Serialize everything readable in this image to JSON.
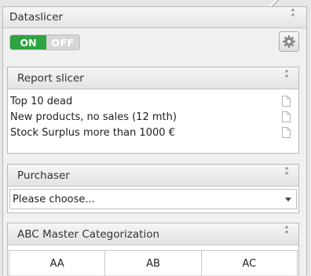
{
  "dataslicer": {
    "title": "Dataslicer"
  },
  "toggle": {
    "on_label": "ON",
    "off_label": "OFF",
    "state": "on"
  },
  "report_slicer": {
    "title": "Report slicer",
    "items": [
      {
        "label": "Top 10 dead"
      },
      {
        "label": "New products, no sales (12 mth)"
      },
      {
        "label": "Stock Surplus more than 1000 €"
      }
    ]
  },
  "purchaser": {
    "title": "Purchaser",
    "selected": "Please choose..."
  },
  "abc": {
    "title": "ABC Master Categorization",
    "cells": [
      {
        "label": "AA"
      },
      {
        "label": "AB"
      },
      {
        "label": "AC"
      }
    ]
  },
  "icons": {
    "collapse": "chevron-double-up-icon",
    "settings": "gear-icon",
    "document": "document-icon",
    "dropdown": "caret-down-icon"
  },
  "colors": {
    "on": "#2fa341",
    "off": "#d6d6d6"
  }
}
